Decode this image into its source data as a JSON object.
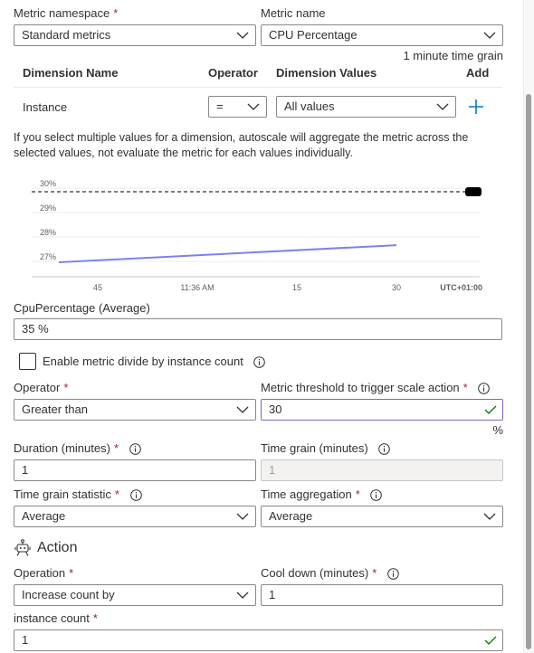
{
  "metric": {
    "namespace_label": "Metric namespace",
    "namespace_value": "Standard metrics",
    "name_label": "Metric name",
    "name_value": "CPU Percentage",
    "time_grain_note": "1 minute time grain",
    "required_mark": "*"
  },
  "dimensions": {
    "headers": {
      "name": "Dimension Name",
      "operator": "Operator",
      "values": "Dimension Values",
      "add": "Add"
    },
    "row": {
      "name": "Instance",
      "operator": "=",
      "values": "All values"
    },
    "note": "If you select multiple values for a dimension, autoscale will aggregate the metric across the selected values, not evaluate the metric for each values individually."
  },
  "chart_data": {
    "type": "line",
    "yticks": [
      "30%",
      "29%",
      "28%",
      "27%"
    ],
    "xticks": [
      "45",
      "11:36 AM",
      "15",
      "30"
    ],
    "timezone": "UTC+01:00",
    "threshold": 30,
    "ylim": [
      26.5,
      30.5
    ],
    "series": [
      {
        "x": [
          0,
          1
        ],
        "values": [
          27.0,
          27.7
        ]
      }
    ],
    "colors": {
      "line": "#7b83eb",
      "threshold": "#323130"
    }
  },
  "aggregate": {
    "label": "CpuPercentage (Average)",
    "value": "35 %"
  },
  "divide": {
    "label": "Enable metric divide by instance count",
    "checked": false
  },
  "criteria": {
    "operator_label": "Operator",
    "operator_value": "Greater than",
    "threshold_label": "Metric threshold to trigger scale action",
    "threshold_value": "30",
    "threshold_unit": "%",
    "duration_label": "Duration (minutes)",
    "duration_value": "1",
    "grain_label": "Time grain (minutes)",
    "grain_value": "1",
    "grain_stat_label": "Time grain statistic",
    "grain_stat_value": "Average",
    "aggregation_label": "Time aggregation",
    "aggregation_value": "Average"
  },
  "action": {
    "title": "Action",
    "operation_label": "Operation",
    "operation_value": "Increase count by",
    "cooldown_label": "Cool down (minutes)",
    "cooldown_value": "1",
    "count_label": "instance count",
    "count_value": "1"
  },
  "icons": {
    "info": "info-icon",
    "chevron": "chevron-down-icon",
    "add": "add-icon",
    "check": "checkmark-icon",
    "action": "robot-icon"
  },
  "colors": {
    "accent": "#0078d4",
    "required": "#a4262c",
    "valid_border": "#8764b8",
    "valid_check": "#107c10"
  }
}
